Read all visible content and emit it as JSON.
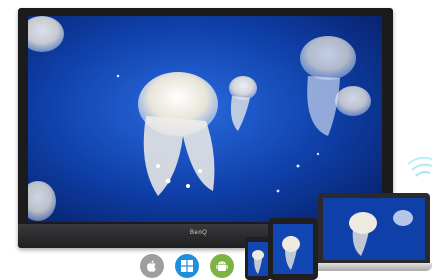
{
  "display": {
    "brand": "BenQ"
  },
  "os_icons": [
    "apple-icon",
    "windows-icon",
    "android-icon"
  ],
  "colors": {
    "screen_deep_blue": "#0a2f8a",
    "screen_bright_blue": "#1d5bd6",
    "jelly_white": "#f2efe6",
    "bezel_dark": "#1b1b1d",
    "apple_grey": "#9e9e9e",
    "windows_blue": "#1f8edb",
    "android_green": "#7cb342",
    "wifi_cyan": "#8fe3f0"
  }
}
